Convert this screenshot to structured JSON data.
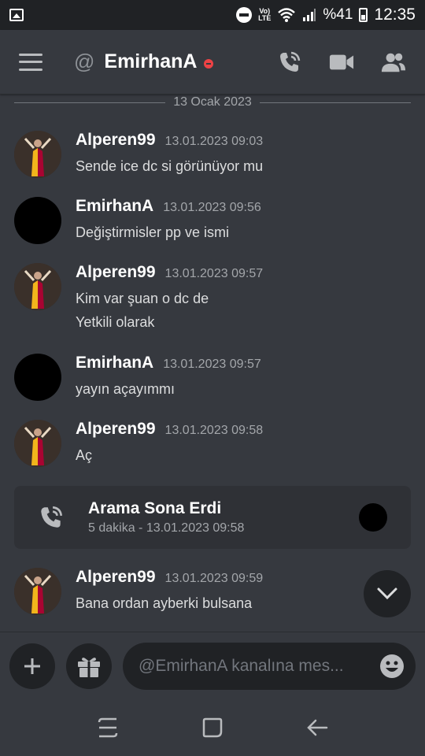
{
  "status_bar": {
    "battery": "%41",
    "time": "12:35",
    "volte_top": "Vo)",
    "volte_bottom": "LTE"
  },
  "header": {
    "title": "EmirhanA",
    "prefix": "@"
  },
  "date_divider": "13 Ocak 2023",
  "messages": [
    {
      "author": "Alperen99",
      "timestamp": "13.01.2023 09:03",
      "lines": [
        "Sende ice dc si görünüyor mu"
      ],
      "avatar": "galatasaray"
    },
    {
      "author": "EmirhanA",
      "timestamp": "13.01.2023 09:56",
      "lines": [
        "Değiştirmisler pp ve ismi"
      ],
      "avatar": "black"
    },
    {
      "author": "Alperen99",
      "timestamp": "13.01.2023 09:57",
      "lines": [
        "Kim var şuan o dc de",
        "Yetkili olarak"
      ],
      "avatar": "galatasaray"
    },
    {
      "author": "EmirhanA",
      "timestamp": "13.01.2023 09:57",
      "lines": [
        "yayın açayımmı"
      ],
      "avatar": "black"
    },
    {
      "author": "Alperen99",
      "timestamp": "13.01.2023 09:58",
      "lines": [
        "Aç"
      ],
      "avatar": "galatasaray"
    },
    {
      "author": "Alperen99",
      "timestamp": "13.01.2023 09:59",
      "lines": [
        "Bana ordan ayberki bulsana"
      ],
      "avatar": "galatasaray"
    }
  ],
  "call": {
    "title": "Arama Sona Erdi",
    "subtitle": "5 dakika - 13.01.2023 09:58"
  },
  "composer": {
    "placeholder": "@EmirhanA kanalına mes..."
  },
  "colors": {
    "background": "#36393f",
    "dark": "#202225",
    "dnd": "#ed4245",
    "gs_yellow": "#f1b51c",
    "gs_red": "#a90432"
  }
}
